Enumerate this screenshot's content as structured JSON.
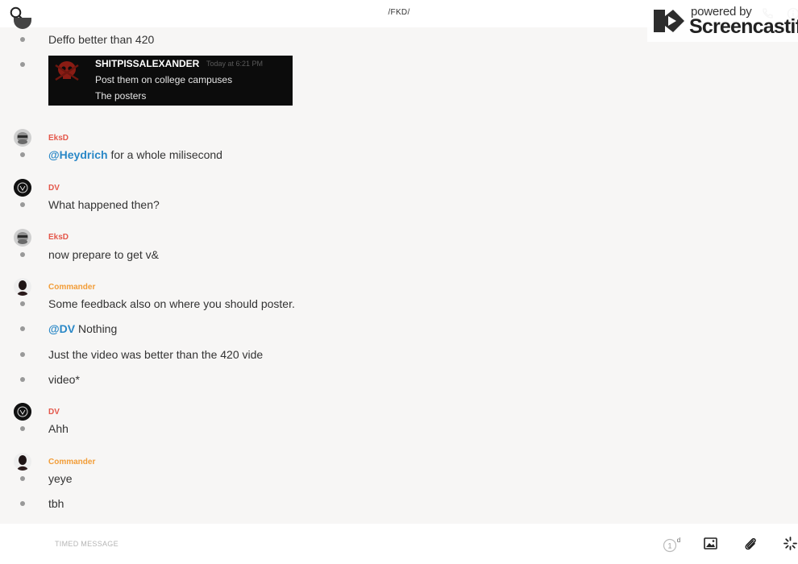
{
  "topbar": {
    "title": "/FKD/",
    "icons": [
      "search-icon",
      "phone-icon",
      "info-icon"
    ]
  },
  "watermark": {
    "powered": "powered by",
    "brand": "Screencastify"
  },
  "colors": {
    "author_red": "#e4574a",
    "author_orange": "#f29d38",
    "mention_blue": "#2a88c7"
  },
  "feed": {
    "m0": "Deffo better than 420",
    "embed": {
      "name": "SHITPISSALEXANDER",
      "time": "Today at 6:21 PM",
      "line1": "Post them on college campuses",
      "line2": "The posters"
    },
    "g1_author": "EksD",
    "m1_mention": "@Heydrich",
    "m1_text": " for a whole milisecond",
    "g2_author": "DV",
    "m2": "What happened then?",
    "g3_author": "EksD",
    "m3": "now prepare to get v&",
    "g4_author": "Commander",
    "m4": "Some feedback also on where you should poster.",
    "m5_mention": "@DV",
    "m5_text": " Nothing",
    "m6": "Just the video was better than the 420 vide",
    "m7": "video*",
    "g5_author": "DV",
    "m8": "Ahh",
    "g6_author": "Commander",
    "m9": "yeye",
    "m10": "tbh"
  },
  "bottombar": {
    "placeholder": "TIMED MESSAGE",
    "timer_value": "1",
    "timer_unit": "d",
    "icons": [
      "timer-icon",
      "image-icon",
      "paperclip-icon",
      "spinner-icon"
    ]
  }
}
